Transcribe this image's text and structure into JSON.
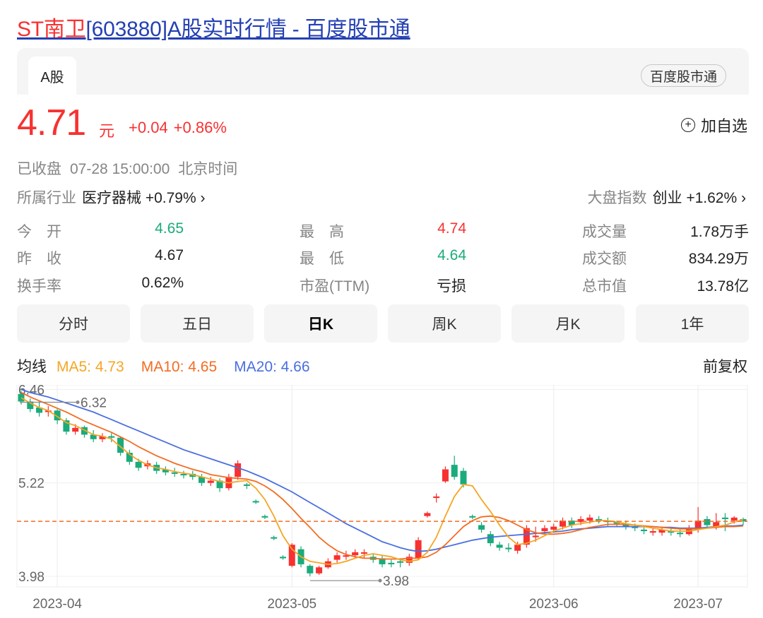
{
  "title": {
    "highlight": "ST南卫",
    "rest": "[603880]A股实时行情 - 百度股市通"
  },
  "tabs": {
    "active": "A股",
    "source": "百度股市通"
  },
  "quote": {
    "price": "4.71",
    "unit": "元",
    "change": "+0.04",
    "change_pct": "+0.86%",
    "add_watch": "加自选",
    "add_icon": "plus-circle-icon",
    "status": "已收盘",
    "time": "07-28 15:00:00",
    "timezone": "北京时间"
  },
  "industry": {
    "label": "所属行业",
    "name": "医疗器械",
    "change": "+0.79%",
    "arrow": "›"
  },
  "index": {
    "label": "大盘指数",
    "name": "创业",
    "change": "+1.62%",
    "arrow": "›"
  },
  "stats": {
    "open_label": "今　开",
    "open": "4.65",
    "prev_label": "昨　收",
    "prev": "4.67",
    "turnover_label": "换手率",
    "turnover": "0.62%",
    "high_label": "最　高",
    "high": "4.74",
    "low_label": "最　低",
    "low": "4.64",
    "pe_label": "市盈(TTM)",
    "pe": "亏损",
    "volume_label": "成交量",
    "volume": "1.78万手",
    "amount_label": "成交额",
    "amount": "834.29万",
    "mcap_label": "总市值",
    "mcap": "13.78亿"
  },
  "periods": [
    "分时",
    "五日",
    "日K",
    "周K",
    "月K",
    "1年"
  ],
  "active_period": "日K",
  "ma": {
    "label": "均线",
    "ma5": "MA5: 4.73",
    "ma10": "MA10: 4.65",
    "ma20": "MA20: 4.66",
    "adjust": "前复权",
    "colors": {
      "ma5": "#f5a623",
      "ma10": "#f36c21",
      "ma20": "#4a6ee0"
    }
  },
  "chart_data": {
    "type": "candlestick",
    "y_labels": [
      "6.46",
      "5.22",
      "3.98"
    ],
    "x_labels": [
      "2023-04",
      "2023-05",
      "2023-06",
      "2023-07"
    ],
    "max_marker": "6.32",
    "min_marker": "3.98",
    "current_price": 4.71,
    "up_color": "#f73131",
    "down_color": "#1aab7c",
    "candles": [
      [
        6.4,
        6.3,
        6.44,
        6.26
      ],
      [
        6.3,
        6.2,
        6.34,
        6.16
      ],
      [
        6.22,
        6.15,
        6.3,
        6.1
      ],
      [
        6.16,
        6.18,
        6.24,
        6.1
      ],
      [
        6.18,
        6.05,
        6.2,
        6.0
      ],
      [
        6.05,
        5.9,
        6.08,
        5.86
      ],
      [
        5.9,
        5.95,
        6.0,
        5.86
      ],
      [
        5.96,
        5.86,
        5.98,
        5.82
      ],
      [
        5.86,
        5.8,
        5.92,
        5.76
      ],
      [
        5.8,
        5.84,
        5.88,
        5.76
      ],
      [
        5.84,
        5.82,
        5.88,
        5.76
      ],
      [
        5.82,
        5.62,
        5.84,
        5.58
      ],
      [
        5.62,
        5.5,
        5.66,
        5.46
      ],
      [
        5.5,
        5.42,
        5.54,
        5.38
      ],
      [
        5.44,
        5.48,
        5.52,
        5.4
      ],
      [
        5.46,
        5.38,
        5.5,
        5.34
      ],
      [
        5.4,
        5.36,
        5.44,
        5.32
      ],
      [
        5.36,
        5.34,
        5.42,
        5.3
      ],
      [
        5.34,
        5.32,
        5.38,
        5.28
      ],
      [
        5.34,
        5.3,
        5.38,
        5.26
      ],
      [
        5.3,
        5.22,
        5.34,
        5.18
      ],
      [
        5.22,
        5.25,
        5.3,
        5.18
      ],
      [
        5.25,
        5.15,
        5.28,
        5.1
      ],
      [
        5.15,
        5.3,
        5.34,
        5.12
      ],
      [
        5.3,
        5.48,
        5.52,
        5.26
      ],
      [
        5.2,
        5.18,
        5.22,
        5.14
      ],
      [
        4.98,
        4.96,
        5.0,
        4.94
      ],
      [
        4.78,
        4.76,
        4.8,
        4.74
      ],
      [
        4.5,
        4.48,
        4.52,
        4.46
      ],
      [
        4.24,
        4.22,
        4.26,
        4.2
      ],
      [
        4.12,
        4.4,
        4.42,
        4.1
      ],
      [
        4.34,
        4.14,
        4.38,
        4.1
      ],
      [
        4.12,
        4.02,
        4.14,
        3.98
      ],
      [
        4.02,
        4.1,
        4.12,
        4.0
      ],
      [
        4.1,
        4.18,
        4.22,
        4.08
      ],
      [
        4.2,
        4.26,
        4.3,
        4.16
      ],
      [
        4.24,
        4.26,
        4.32,
        4.2
      ],
      [
        4.26,
        4.3,
        4.34,
        4.22
      ],
      [
        4.28,
        4.3,
        4.34,
        4.22
      ],
      [
        4.24,
        4.2,
        4.28,
        4.16
      ],
      [
        4.22,
        4.14,
        4.26,
        4.1
      ],
      [
        4.16,
        4.14,
        4.2,
        4.1
      ],
      [
        4.18,
        4.16,
        4.22,
        4.1
      ],
      [
        4.16,
        4.24,
        4.28,
        4.12
      ],
      [
        4.22,
        4.46,
        4.5,
        4.2
      ],
      [
        4.78,
        4.82,
        4.84,
        4.76
      ],
      [
        5.02,
        5.04,
        5.08,
        4.96
      ],
      [
        5.24,
        5.4,
        5.44,
        5.22
      ],
      [
        5.46,
        5.3,
        5.58,
        5.26
      ],
      [
        5.38,
        5.2,
        5.42,
        5.16
      ],
      [
        4.78,
        4.76,
        4.8,
        4.74
      ],
      [
        4.66,
        4.6,
        4.7,
        4.56
      ],
      [
        4.54,
        4.42,
        4.58,
        4.38
      ],
      [
        4.4,
        4.36,
        4.44,
        4.32
      ],
      [
        4.36,
        4.34,
        4.42,
        4.3
      ],
      [
        4.32,
        4.4,
        4.44,
        4.28
      ],
      [
        4.4,
        4.62,
        4.66,
        4.36
      ],
      [
        4.5,
        4.52,
        4.64,
        4.44
      ],
      [
        4.58,
        4.62,
        4.66,
        4.54
      ],
      [
        4.6,
        4.64,
        4.68,
        4.56
      ],
      [
        4.64,
        4.72,
        4.76,
        4.6
      ],
      [
        4.72,
        4.66,
        4.76,
        4.62
      ],
      [
        4.7,
        4.74,
        4.78,
        4.66
      ],
      [
        4.72,
        4.76,
        4.8,
        4.68
      ],
      [
        4.74,
        4.72,
        4.78,
        4.68
      ],
      [
        4.72,
        4.7,
        4.76,
        4.64
      ],
      [
        4.7,
        4.68,
        4.72,
        4.64
      ],
      [
        4.68,
        4.64,
        4.72,
        4.6
      ],
      [
        4.64,
        4.62,
        4.68,
        4.58
      ],
      [
        4.6,
        4.58,
        4.64,
        4.54
      ],
      [
        4.56,
        4.58,
        4.62,
        4.52
      ],
      [
        4.56,
        4.6,
        4.64,
        4.52
      ],
      [
        4.58,
        4.56,
        4.62,
        4.52
      ],
      [
        4.56,
        4.54,
        4.6,
        4.5
      ],
      [
        4.54,
        4.62,
        4.66,
        4.52
      ],
      [
        4.6,
        4.72,
        4.9,
        4.56
      ],
      [
        4.74,
        4.66,
        4.78,
        4.62
      ],
      [
        4.64,
        4.7,
        4.82,
        4.6
      ],
      [
        4.76,
        4.74,
        4.82,
        4.58
      ],
      [
        4.72,
        4.76,
        4.78,
        4.68
      ],
      [
        4.74,
        4.71,
        4.76,
        4.66
      ]
    ],
    "ma5": [
      6.35,
      6.28,
      6.22,
      6.18,
      6.1,
      6.02,
      5.98,
      5.92,
      5.86,
      5.84,
      5.8,
      5.7,
      5.6,
      5.52,
      5.46,
      5.42,
      5.4,
      5.37,
      5.35,
      5.33,
      5.3,
      5.27,
      5.24,
      5.22,
      5.24,
      5.25,
      5.15,
      5.0,
      4.78,
      4.52,
      4.34,
      4.24,
      4.18,
      4.16,
      4.14,
      4.15,
      4.18,
      4.22,
      4.26,
      4.28,
      4.26,
      4.24,
      4.2,
      4.18,
      4.2,
      4.3,
      4.5,
      4.78,
      5.04,
      5.2,
      5.18,
      5.0,
      4.84,
      4.66,
      4.5,
      4.4,
      4.42,
      4.46,
      4.52,
      4.58,
      4.62,
      4.66,
      4.68,
      4.7,
      4.72,
      4.72,
      4.7,
      4.68,
      4.66,
      4.64,
      4.62,
      4.6,
      4.58,
      4.58,
      4.58,
      4.6,
      4.62,
      4.64,
      4.66,
      4.7,
      4.73
    ],
    "ma10": [
      6.42,
      6.36,
      6.31,
      6.26,
      6.21,
      6.16,
      6.1,
      6.04,
      5.99,
      5.94,
      5.89,
      5.83,
      5.77,
      5.7,
      5.64,
      5.58,
      5.53,
      5.48,
      5.44,
      5.4,
      5.37,
      5.33,
      5.31,
      5.29,
      5.28,
      5.27,
      5.24,
      5.18,
      5.1,
      5.0,
      4.88,
      4.75,
      4.63,
      4.5,
      4.4,
      4.32,
      4.27,
      4.24,
      4.22,
      4.22,
      4.21,
      4.21,
      4.21,
      4.22,
      4.22,
      4.24,
      4.3,
      4.4,
      4.52,
      4.64,
      4.72,
      4.77,
      4.78,
      4.76,
      4.72,
      4.66,
      4.6,
      4.56,
      4.54,
      4.54,
      4.55,
      4.57,
      4.6,
      4.63,
      4.65,
      4.67,
      4.67,
      4.67,
      4.66,
      4.65,
      4.64,
      4.63,
      4.62,
      4.61,
      4.61,
      4.61,
      4.62,
      4.63,
      4.64,
      4.64,
      4.65
    ],
    "ma20": [
      6.46,
      6.42,
      6.39,
      6.36,
      6.32,
      6.28,
      6.24,
      6.2,
      6.16,
      6.11,
      6.06,
      6.01,
      5.96,
      5.91,
      5.86,
      5.81,
      5.76,
      5.71,
      5.66,
      5.62,
      5.58,
      5.54,
      5.5,
      5.46,
      5.42,
      5.38,
      5.33,
      5.28,
      5.22,
      5.16,
      5.1,
      5.03,
      4.96,
      4.89,
      4.82,
      4.75,
      4.68,
      4.62,
      4.56,
      4.5,
      4.44,
      4.4,
      4.36,
      4.33,
      4.31,
      4.32,
      4.34,
      4.37,
      4.4,
      4.43,
      4.46,
      4.48,
      4.5,
      4.51,
      4.52,
      4.53,
      4.54,
      4.55,
      4.56,
      4.57,
      4.58,
      4.6,
      4.61,
      4.62,
      4.63,
      4.64,
      4.64,
      4.64,
      4.64,
      4.64,
      4.64,
      4.63,
      4.63,
      4.62,
      4.62,
      4.62,
      4.63,
      4.64,
      4.65,
      4.65,
      4.66
    ]
  }
}
